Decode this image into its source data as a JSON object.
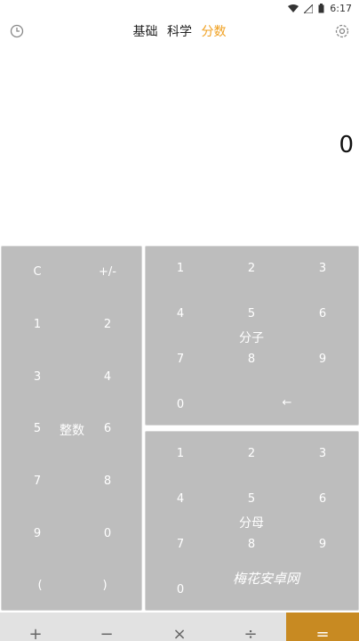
{
  "status_bar": {
    "time": "6:17"
  },
  "header": {
    "tabs": [
      {
        "label": "基础",
        "active": false
      },
      {
        "label": "科学",
        "active": false
      },
      {
        "label": "分数",
        "active": true
      }
    ],
    "accent_color": "#f0a020"
  },
  "display": {
    "value": "0"
  },
  "integer_panel": {
    "label": "整数",
    "keys": [
      "C",
      "+/-",
      "1",
      "2",
      "3",
      "4",
      "5",
      "6",
      "7",
      "8",
      "9",
      "0",
      "(",
      ")"
    ]
  },
  "numerator_panel": {
    "label": "分子",
    "keys": [
      "1",
      "2",
      "3",
      "4",
      "5",
      "6",
      "7",
      "8",
      "9",
      "0",
      "←"
    ]
  },
  "denominator_panel": {
    "label": "分母",
    "keys": [
      "1",
      "2",
      "3",
      "4",
      "5",
      "6",
      "7",
      "8",
      "9",
      "0"
    ]
  },
  "operators": [
    "+",
    "−",
    "×",
    "÷"
  ],
  "equals_label": "=",
  "equals_color": "#c88a22",
  "watermark": "梅花安卓网"
}
